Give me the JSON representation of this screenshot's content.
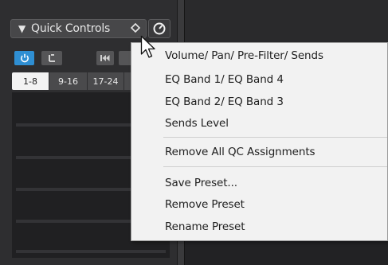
{
  "quick_controls": {
    "title": "Quick Controls",
    "collapse_glyph": "▼",
    "preset_icon": "diamond-outline-icon",
    "power_icon": "power-circle-icon"
  },
  "toolbar": {
    "activate_icon": "power-icon",
    "link_icon": "link-icon",
    "prev_icon": "skip-back-icon"
  },
  "tabs": [
    {
      "label": "1-8",
      "active": true
    },
    {
      "label": "9-16",
      "active": false
    },
    {
      "label": "17-24",
      "active": false
    }
  ],
  "context_menu": {
    "group1": [
      {
        "label": "Volume/ Pan/ Pre-Filter/ Sends"
      },
      {
        "label": "EQ Band 1/ EQ Band 4"
      },
      {
        "label": "EQ Band 2/ EQ Band 3"
      },
      {
        "label": "Sends Level"
      }
    ],
    "group2": [
      {
        "label": "Remove All QC Assignments"
      }
    ],
    "group3": [
      {
        "label": "Save Preset..."
      },
      {
        "label": "Remove Preset"
      },
      {
        "label": "Rename Preset"
      }
    ]
  },
  "colors": {
    "accent": "#2f8fd3",
    "menu_bg": "#f2f2f2",
    "panel_bg": "#2e2e30"
  }
}
